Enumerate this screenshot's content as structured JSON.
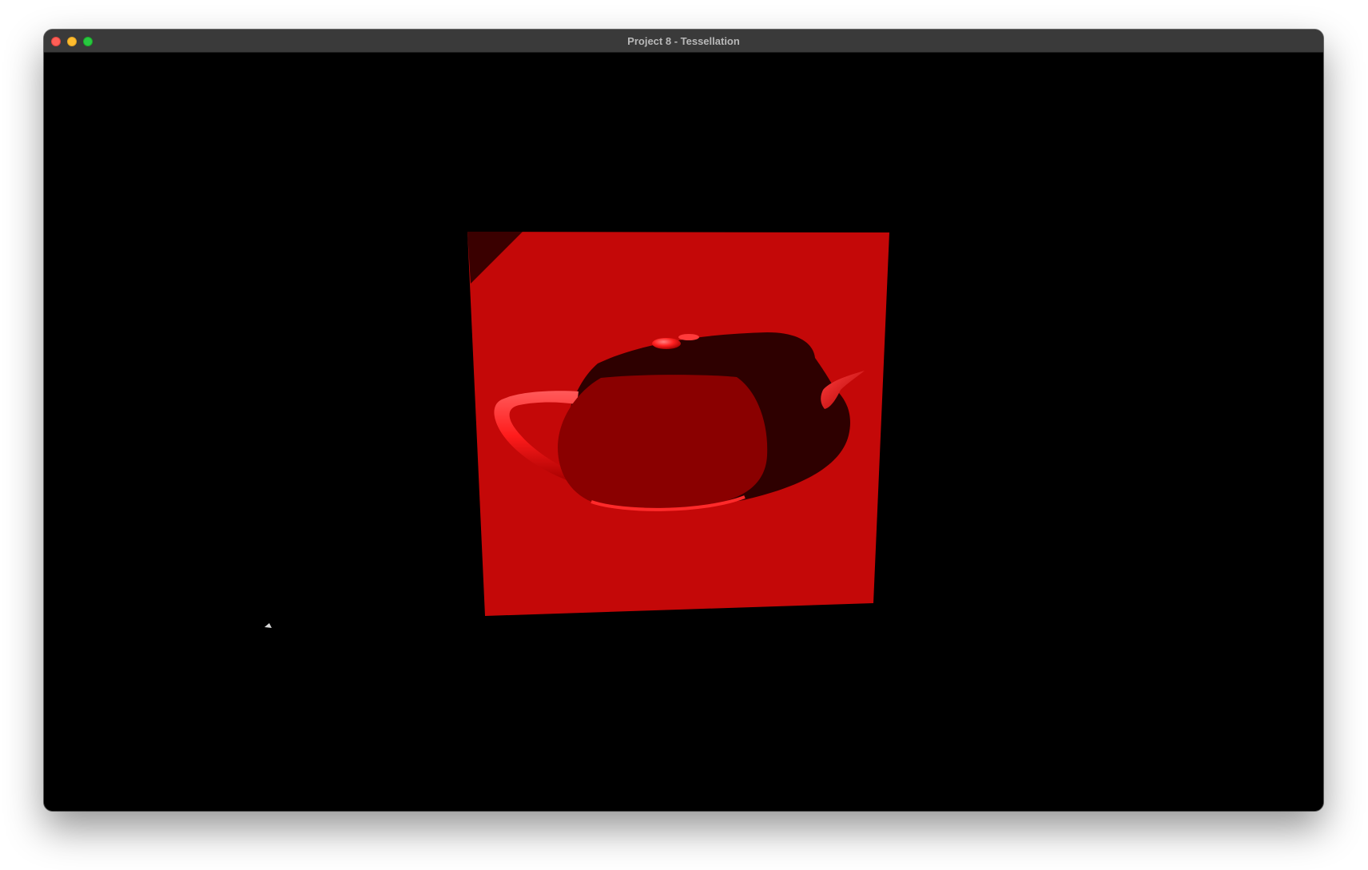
{
  "window": {
    "title": "Project 8 - Tessellation",
    "controls": {
      "close": "close-button",
      "minimize": "minimize-button",
      "zoom": "zoom-button"
    }
  },
  "scene": {
    "background_color": "#000000",
    "plane_color": "#ff1e1e",
    "teapot_color": "#ff1a1a",
    "shadow_color": "#2e0000"
  }
}
